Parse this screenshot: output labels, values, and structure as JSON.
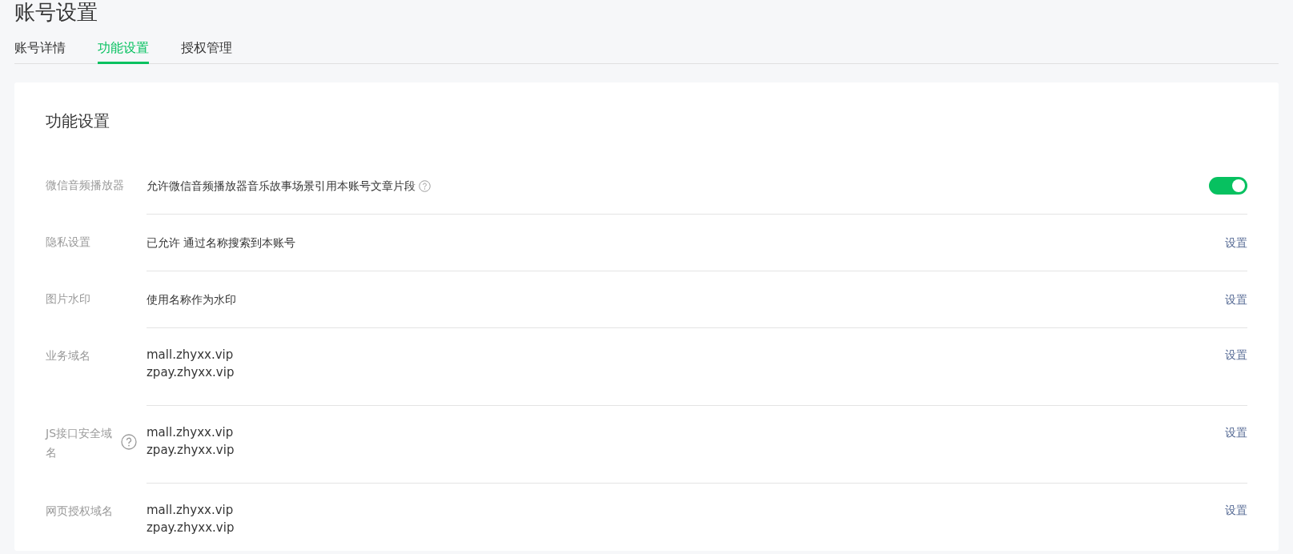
{
  "page_title": "账号设置",
  "tabs": [
    {
      "label": "账号详情",
      "selected": false
    },
    {
      "label": "功能设置",
      "selected": true
    },
    {
      "label": "授权管理",
      "selected": false
    }
  ],
  "section": {
    "title": "功能设置",
    "rows": [
      {
        "label": "微信音频播放器",
        "label_help": false,
        "kind": "toggle",
        "lines": [
          "允许微信音频播放器音乐故事场景引用本账号文章片段"
        ],
        "text_help": true,
        "on": true
      },
      {
        "label": "隐私设置",
        "label_help": false,
        "kind": "link",
        "lines": [
          "已允许 通过名称搜索到本账号"
        ],
        "text_help": false,
        "action": "设置"
      },
      {
        "label": "图片水印",
        "label_help": false,
        "kind": "link",
        "lines": [
          "使用名称作为水印"
        ],
        "text_help": false,
        "action": "设置"
      },
      {
        "label": "业务域名",
        "label_help": false,
        "kind": "link",
        "lines": [
          "mall.zhyxx.vip",
          "zpay.zhyxx.vip"
        ],
        "text_help": false,
        "action": "设置"
      },
      {
        "label": "JS接口安全域名",
        "label_help": true,
        "kind": "link",
        "lines": [
          "mall.zhyxx.vip",
          "zpay.zhyxx.vip"
        ],
        "text_help": false,
        "action": "设置"
      },
      {
        "label": "网页授权域名",
        "label_help": false,
        "kind": "link",
        "lines": [
          "mall.zhyxx.vip",
          "zpay.zhyxx.vip"
        ],
        "text_help": false,
        "action": "设置"
      }
    ]
  }
}
